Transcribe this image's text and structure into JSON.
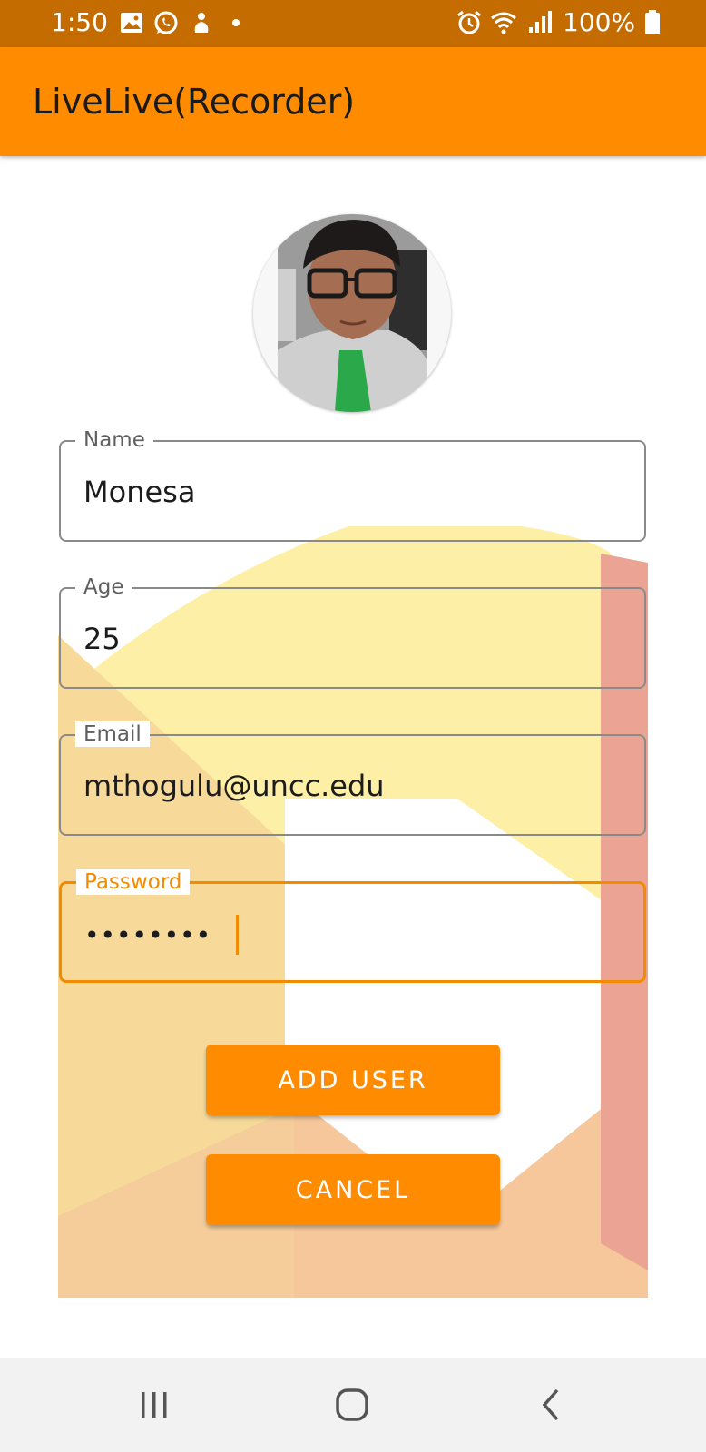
{
  "status_bar": {
    "time": "1:50",
    "battery_text": "100%",
    "icons": [
      "image-icon",
      "whatsapp-icon",
      "notification-icon",
      "dot-icon",
      "alarm-icon",
      "wifi-icon",
      "signal-icon",
      "battery-icon"
    ]
  },
  "app_bar": {
    "title": "LiveLive(Recorder)"
  },
  "form": {
    "name": {
      "label": "Name",
      "value": "Monesa"
    },
    "age": {
      "label": "Age",
      "value": "25"
    },
    "email": {
      "label": "Email",
      "value": "mthogulu@uncc.edu"
    },
    "password": {
      "label": "Password",
      "value": "••••••••"
    }
  },
  "buttons": {
    "add_user": "ADD USER",
    "cancel": "CANCEL"
  },
  "nav_bar": {
    "icons": [
      "recent-apps-icon",
      "home-icon",
      "back-icon"
    ]
  },
  "colors": {
    "status_bar": "#c46c00",
    "app_bar": "#ff8c00",
    "accent": "#f28b00",
    "button": "#ff8c00"
  }
}
